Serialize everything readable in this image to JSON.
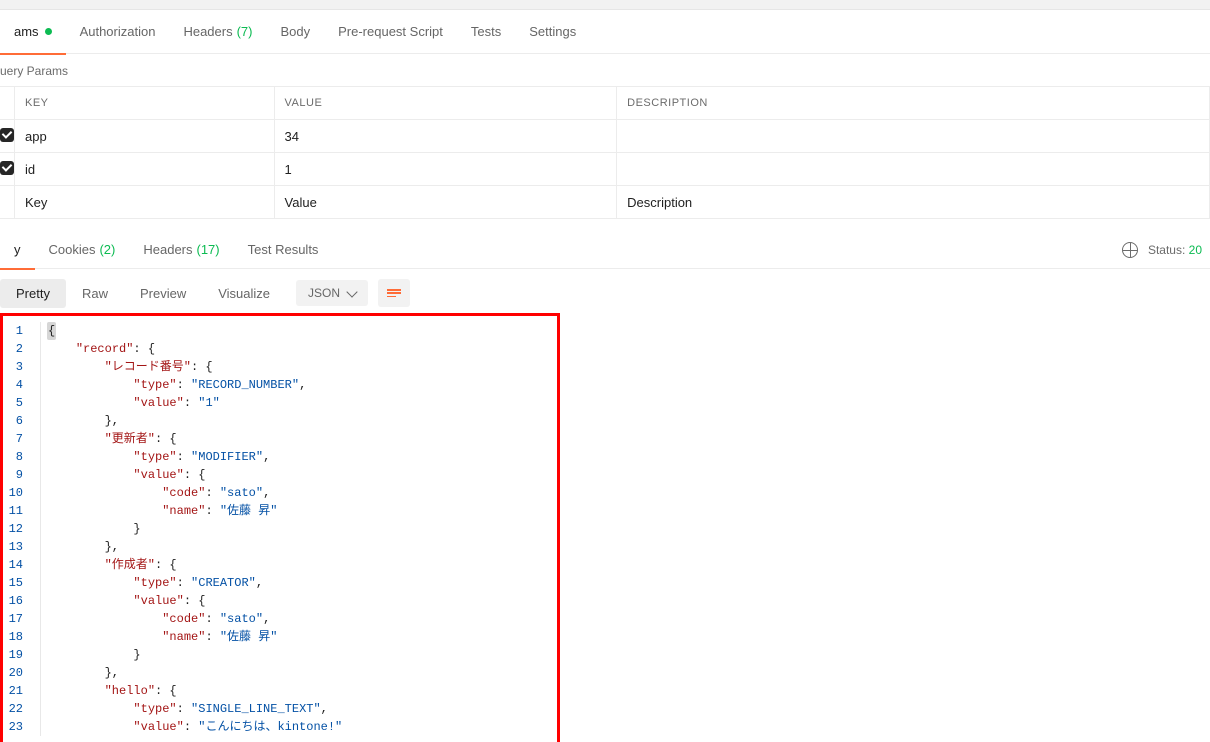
{
  "request_tabs": [
    {
      "label": "ams",
      "dot": true,
      "active": true
    },
    {
      "label": "Authorization"
    },
    {
      "label": "Headers",
      "count": "(7)"
    },
    {
      "label": "Body"
    },
    {
      "label": "Pre-request Script"
    },
    {
      "label": "Tests"
    },
    {
      "label": "Settings"
    }
  ],
  "query_section_title": "uery Params",
  "table": {
    "headers": {
      "key": "KEY",
      "value": "VALUE",
      "desc": "DESCRIPTION"
    },
    "rows": [
      {
        "key": "app",
        "value": "34"
      },
      {
        "key": "id",
        "value": "1"
      }
    ],
    "placeholders": {
      "key": "Key",
      "value": "Value",
      "desc": "Description"
    }
  },
  "response_tabs": [
    {
      "label": "y",
      "active": true
    },
    {
      "label": "Cookies",
      "count": "(2)"
    },
    {
      "label": "Headers",
      "count": "(17)"
    },
    {
      "label": "Test Results"
    }
  ],
  "status": {
    "label": "Status:",
    "code": "20"
  },
  "view_opts": [
    "Pretty",
    "Raw",
    "Preview",
    "Visualize"
  ],
  "format_dd": "JSON",
  "json": {
    "tokens": [
      [
        {
          "t": "{",
          "c": "p",
          "hl": true
        }
      ],
      [
        {
          "t": "    ",
          "c": "p"
        },
        {
          "t": "\"record\"",
          "c": "k"
        },
        {
          "t": ": {",
          "c": "p"
        }
      ],
      [
        {
          "t": "        ",
          "c": "p"
        },
        {
          "t": "\"レコード番号\"",
          "c": "k"
        },
        {
          "t": ": {",
          "c": "p"
        }
      ],
      [
        {
          "t": "            ",
          "c": "p"
        },
        {
          "t": "\"type\"",
          "c": "k"
        },
        {
          "t": ": ",
          "c": "p"
        },
        {
          "t": "\"RECORD_NUMBER\"",
          "c": "s"
        },
        {
          "t": ",",
          "c": "p"
        }
      ],
      [
        {
          "t": "            ",
          "c": "p"
        },
        {
          "t": "\"value\"",
          "c": "k"
        },
        {
          "t": ": ",
          "c": "p"
        },
        {
          "t": "\"1\"",
          "c": "s"
        }
      ],
      [
        {
          "t": "        ",
          "c": "p"
        },
        {
          "t": "},",
          "c": "p"
        }
      ],
      [
        {
          "t": "        ",
          "c": "p"
        },
        {
          "t": "\"更新者\"",
          "c": "k"
        },
        {
          "t": ": {",
          "c": "p"
        }
      ],
      [
        {
          "t": "            ",
          "c": "p"
        },
        {
          "t": "\"type\"",
          "c": "k"
        },
        {
          "t": ": ",
          "c": "p"
        },
        {
          "t": "\"MODIFIER\"",
          "c": "s"
        },
        {
          "t": ",",
          "c": "p"
        }
      ],
      [
        {
          "t": "            ",
          "c": "p"
        },
        {
          "t": "\"value\"",
          "c": "k"
        },
        {
          "t": ": {",
          "c": "p"
        }
      ],
      [
        {
          "t": "                ",
          "c": "p"
        },
        {
          "t": "\"code\"",
          "c": "k"
        },
        {
          "t": ": ",
          "c": "p"
        },
        {
          "t": "\"sato\"",
          "c": "s"
        },
        {
          "t": ",",
          "c": "p"
        }
      ],
      [
        {
          "t": "                ",
          "c": "p"
        },
        {
          "t": "\"name\"",
          "c": "k"
        },
        {
          "t": ": ",
          "c": "p"
        },
        {
          "t": "\"佐藤 昇\"",
          "c": "s"
        }
      ],
      [
        {
          "t": "            ",
          "c": "p"
        },
        {
          "t": "}",
          "c": "p"
        }
      ],
      [
        {
          "t": "        ",
          "c": "p"
        },
        {
          "t": "},",
          "c": "p"
        }
      ],
      [
        {
          "t": "        ",
          "c": "p"
        },
        {
          "t": "\"作成者\"",
          "c": "k"
        },
        {
          "t": ": {",
          "c": "p"
        }
      ],
      [
        {
          "t": "            ",
          "c": "p"
        },
        {
          "t": "\"type\"",
          "c": "k"
        },
        {
          "t": ": ",
          "c": "p"
        },
        {
          "t": "\"CREATOR\"",
          "c": "s"
        },
        {
          "t": ",",
          "c": "p"
        }
      ],
      [
        {
          "t": "            ",
          "c": "p"
        },
        {
          "t": "\"value\"",
          "c": "k"
        },
        {
          "t": ": {",
          "c": "p"
        }
      ],
      [
        {
          "t": "                ",
          "c": "p"
        },
        {
          "t": "\"code\"",
          "c": "k"
        },
        {
          "t": ": ",
          "c": "p"
        },
        {
          "t": "\"sato\"",
          "c": "s"
        },
        {
          "t": ",",
          "c": "p"
        }
      ],
      [
        {
          "t": "                ",
          "c": "p"
        },
        {
          "t": "\"name\"",
          "c": "k"
        },
        {
          "t": ": ",
          "c": "p"
        },
        {
          "t": "\"佐藤 昇\"",
          "c": "s"
        }
      ],
      [
        {
          "t": "            ",
          "c": "p"
        },
        {
          "t": "}",
          "c": "p"
        }
      ],
      [
        {
          "t": "        ",
          "c": "p"
        },
        {
          "t": "},",
          "c": "p"
        }
      ],
      [
        {
          "t": "        ",
          "c": "p"
        },
        {
          "t": "\"hello\"",
          "c": "k"
        },
        {
          "t": ": {",
          "c": "p"
        }
      ],
      [
        {
          "t": "            ",
          "c": "p"
        },
        {
          "t": "\"type\"",
          "c": "k"
        },
        {
          "t": ": ",
          "c": "p"
        },
        {
          "t": "\"SINGLE_LINE_TEXT\"",
          "c": "s"
        },
        {
          "t": ",",
          "c": "p"
        }
      ],
      [
        {
          "t": "            ",
          "c": "p"
        },
        {
          "t": "\"value\"",
          "c": "k"
        },
        {
          "t": ": ",
          "c": "p"
        },
        {
          "t": "\"こんにちは、kintone!\"",
          "c": "s"
        }
      ]
    ]
  }
}
